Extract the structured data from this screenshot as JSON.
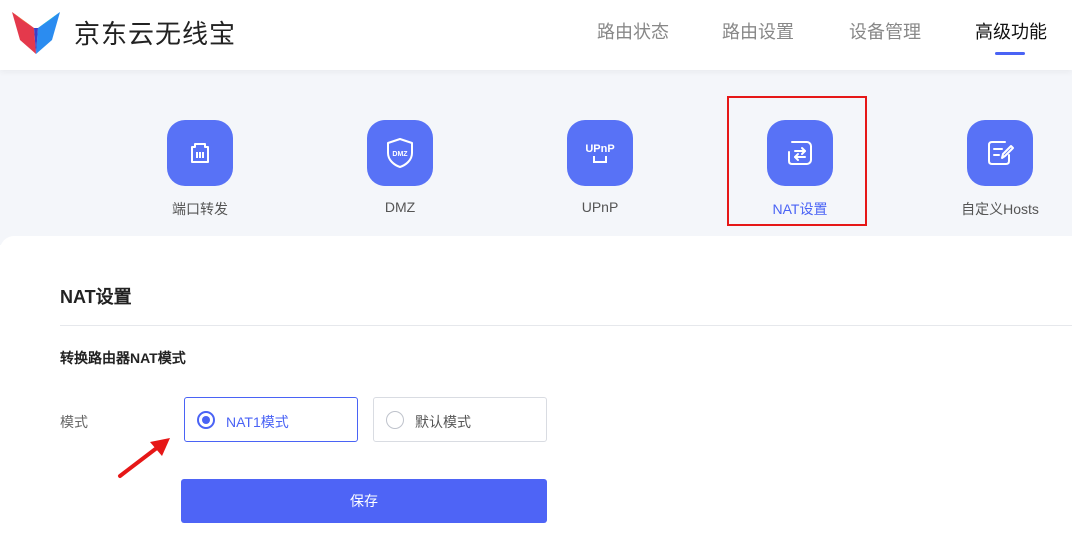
{
  "header": {
    "brand": "京东云无线宝",
    "nav": [
      {
        "label": "路由状态"
      },
      {
        "label": "路由设置"
      },
      {
        "label": "设备管理"
      },
      {
        "label": "高级功能",
        "active": true
      }
    ]
  },
  "features": [
    {
      "label": "端口转发",
      "icon": "port-forward-icon"
    },
    {
      "label": "DMZ",
      "icon": "dmz-shield-icon"
    },
    {
      "label": "UPnP",
      "icon": "upnp-icon"
    },
    {
      "label": "NAT设置",
      "icon": "nat-switch-icon",
      "active": true
    },
    {
      "label": "自定义Hosts",
      "icon": "edit-note-icon"
    }
  ],
  "section": {
    "title": "NAT设置",
    "subtitle": "转换路由器NAT模式",
    "mode_label": "模式",
    "options": [
      {
        "label": "NAT1模式",
        "selected": true
      },
      {
        "label": "默认模式",
        "selected": false
      }
    ],
    "save_label": "保存"
  },
  "icon_text": {
    "dmz": "DMZ",
    "upnp": "UPnP"
  },
  "colors": {
    "accent": "#4a63f5",
    "tile": "#5872f6",
    "highlight": "#e61717",
    "band": "#f4f6fa"
  }
}
